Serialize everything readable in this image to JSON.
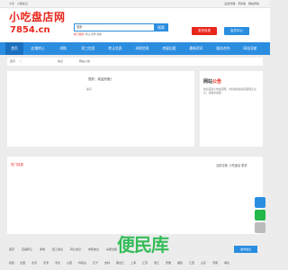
{
  "topbar": {
    "greeting": "今天",
    "weather": "小雨多云",
    "links": [
      "设置管理",
      "手机版",
      "网站导航"
    ]
  },
  "header": {
    "logo_line1": "小吃盘店网",
    "logo_line2": "7854.cn",
    "search_placeholder": "搜索",
    "search_button": "搜索",
    "hot_label": "热门搜索:",
    "hot_terms": "转让 招聘 求职",
    "publish_button": "发布信息",
    "member_button": "会员中心"
  },
  "nav": {
    "items": [
      "首页",
      "店铺转让",
      "求购",
      "招工信息",
      "转让信息",
      "求职信息",
      "房屋出租",
      "最新资讯",
      "服务合作",
      "网站导航"
    ]
  },
  "breadcrumb": {
    "home": "首页",
    "sep": ">",
    "current": "信息",
    "tail": "网站公告"
  },
  "welcome": {
    "greeting": "您好，欢迎光临！",
    "label": "提示"
  },
  "notice": {
    "title_a": "网站",
    "title_b": "公告",
    "text": "欢迎来到小吃盘店网，为您提供最新店铺转让信息，请联系客服。"
  },
  "hot": {
    "title": "热门信息",
    "more_prefix": "当前位置:",
    "more": "小吃盘店 更多"
  },
  "bottom_nav": {
    "items": [
      "首页",
      "店铺转让",
      "求购",
      "招工信息",
      "转让信息",
      "求职信息",
      "房屋出租"
    ],
    "button": "发布信息"
  },
  "region": {
    "label": "地区:",
    "items": [
      "全国",
      "北京",
      "天津",
      "河北",
      "山西",
      "内蒙古",
      "辽宁",
      "吉林",
      "黑龙江",
      "上海",
      "江苏",
      "浙江",
      "安徽",
      "福建",
      "江西",
      "山东",
      "河南",
      "湖北"
    ]
  },
  "watermark": "便民库"
}
